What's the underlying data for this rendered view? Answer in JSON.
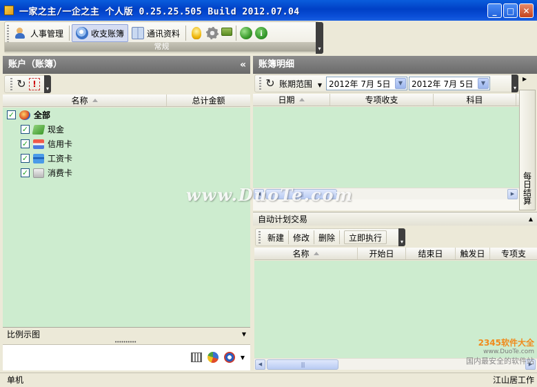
{
  "window": {
    "title": "一家之主/一企之主 个人版 0.25.25.505 Build 2012.07.04",
    "min_label": "_",
    "max_label": "□",
    "close_label": "✕"
  },
  "toolbar": {
    "items": [
      {
        "label": "人事管理",
        "icon": "people-icon"
      },
      {
        "label": "收支账簿",
        "icon": "account-icon"
      },
      {
        "label": "通讯资料",
        "icon": "address-book-icon"
      }
    ],
    "group_label": "常规",
    "extra_icons": [
      "bulb-icon",
      "gear-icon",
      "sign-icon",
      "globe-icon",
      "info-icon"
    ],
    "info_glyph": "i"
  },
  "left_panel": {
    "title": "账户（账簿）",
    "collapse_glyph": "«",
    "columns": [
      "名称",
      "总计金额"
    ],
    "tree": [
      {
        "label": "全部",
        "checked": true
      },
      {
        "label": "现金",
        "checked": true
      },
      {
        "label": "信用卡",
        "checked": true
      },
      {
        "label": "工资卡",
        "checked": true
      },
      {
        "label": "消费卡",
        "checked": true
      }
    ],
    "chart_dropdown": "比例示图",
    "splitter": "••••••••••"
  },
  "right_panel": {
    "title": "账簿明细",
    "range_label": "账期范围",
    "date_from": "2012年 7月 5日",
    "date_to": "2012年 7月 5日",
    "columns": [
      "日期",
      "专项收支",
      "科目"
    ],
    "side_tab": "每日结算",
    "thumb_glyph": "|||"
  },
  "auto_plan": {
    "title": "自动计划交易",
    "buttons": [
      "新建",
      "修改",
      "删除",
      "立即执行"
    ],
    "columns": [
      "名称",
      "开始日",
      "结束日",
      "触发日",
      "专项支"
    ]
  },
  "status": {
    "left": "单机",
    "right": "江山居工作"
  },
  "watermark": {
    "center": "www.DuoTe.com",
    "brand": "2345软件大全",
    "brand_url": "www.DuoTe.com",
    "slogan": "国内最安全的软件站"
  }
}
